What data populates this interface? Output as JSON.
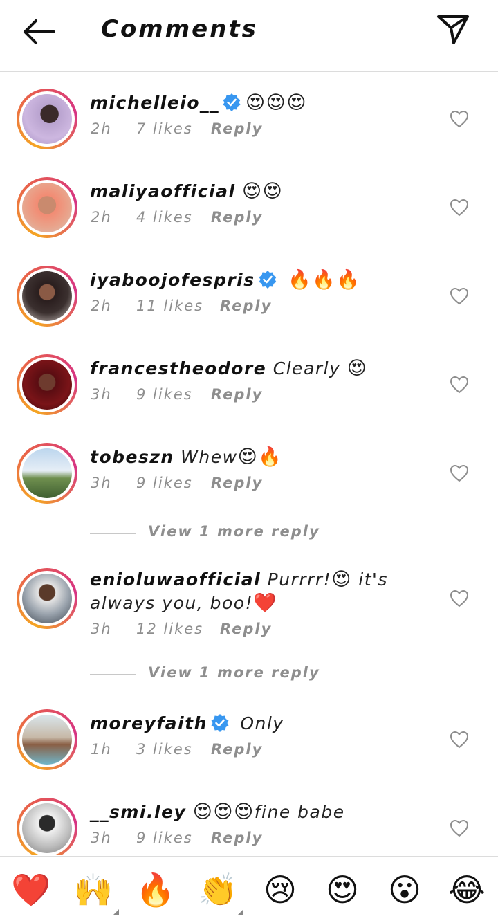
{
  "header": {
    "title": "Comments"
  },
  "comments": [
    {
      "username": "michelleio__",
      "verified": true,
      "text": "",
      "emoji": "😍😍😍",
      "time": "2h",
      "likes": "7 likes",
      "reply": "Reply"
    },
    {
      "username": "maliyaofficial",
      "verified": false,
      "text": "",
      "emoji": "😍😍",
      "time": "2h",
      "likes": "4 likes",
      "reply": "Reply"
    },
    {
      "username": "iyaboojofespris",
      "verified": true,
      "text": "",
      "emoji": "🔥🔥🔥",
      "time": "2h",
      "likes": "11 likes",
      "reply": "Reply"
    },
    {
      "username": "francestheodore",
      "verified": false,
      "text": "Clearly",
      "emoji": "😍",
      "time": "3h",
      "likes": "9 likes",
      "reply": "Reply"
    },
    {
      "username": "tobeszn",
      "verified": false,
      "text": "Whew",
      "emoji": "😍🔥",
      "time": "3h",
      "likes": "9 likes",
      "reply": "Reply"
    },
    {
      "username": "enioluwaofficial",
      "verified": false,
      "text": "Purrrr!",
      "emoji": "😍",
      "text2": "it's always you, boo!",
      "emoji2": "❤️",
      "time": "3h",
      "likes": "12 likes",
      "reply": "Reply"
    },
    {
      "username": "moreyfaith",
      "verified": true,
      "text": "Only",
      "emoji": "",
      "time": "1h",
      "likes": "3 likes",
      "reply": "Reply"
    },
    {
      "username": "__smi.ley",
      "verified": false,
      "text": "fine babe",
      "emoji": "😍😍😍",
      "time": "3h",
      "likes": "9 likes",
      "reply": "Reply"
    }
  ],
  "view_more": [
    {
      "label": "View 1 more reply"
    },
    {
      "label": "View 1 more reply"
    }
  ],
  "reactions": [
    "❤️",
    "🙌",
    "🔥",
    "👏",
    "😢",
    "😍",
    "😮",
    "😂"
  ],
  "colors": {
    "verified": "#3897f0",
    "meta_text": "#8e8e8e",
    "ring_start": "#f5a623",
    "ring_end": "#d63384"
  }
}
